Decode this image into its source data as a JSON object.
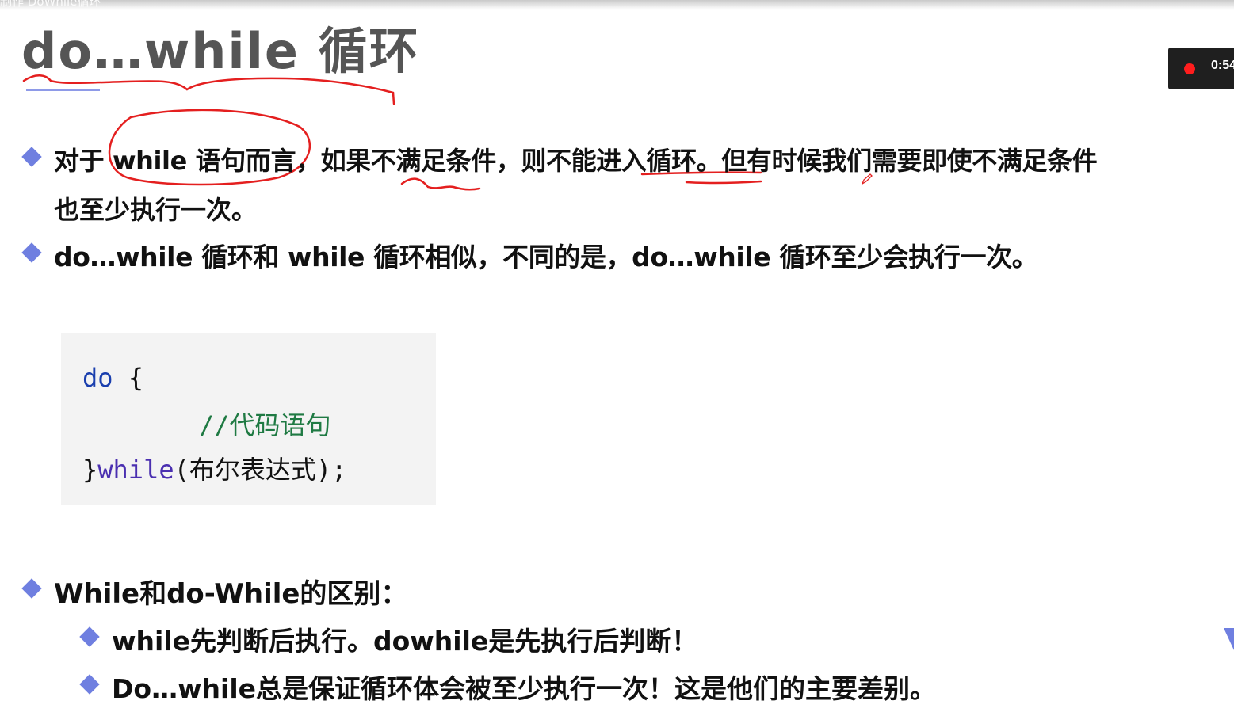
{
  "video": {
    "title": "制作 DoWhile循环"
  },
  "slide": {
    "title": "do…while 循环",
    "bullets": [
      {
        "text": "对于 while 语句而言，如果不满足条件，则不能进入循环。但有时候我们需要即使不满足条件",
        "continuation": "也至少执行一次。"
      },
      {
        "text": "do…while 循环和 while 循环相似，不同的是，do…while 循环至少会执行一次。"
      },
      {
        "text": "While和do-While的区别：",
        "sub": [
          "while先判断后执行。dowhile是先执行后判断！",
          "Do…while总是保证循环体会被至少执行一次！这是他们的主要差别。"
        ]
      }
    ],
    "code": {
      "line1_keyword": "do",
      "line1_brace": " {",
      "line2_comment": "//代码语句",
      "line3_brace": "}",
      "line3_keyword": "while",
      "line3_rest": "(布尔表达式);"
    }
  },
  "recording": {
    "time": "0:54"
  },
  "colors": {
    "accent": "#6f7fe0",
    "annotation": "#e41f1f",
    "keyword": "#1a3fae",
    "comment": "#1f7a43"
  }
}
